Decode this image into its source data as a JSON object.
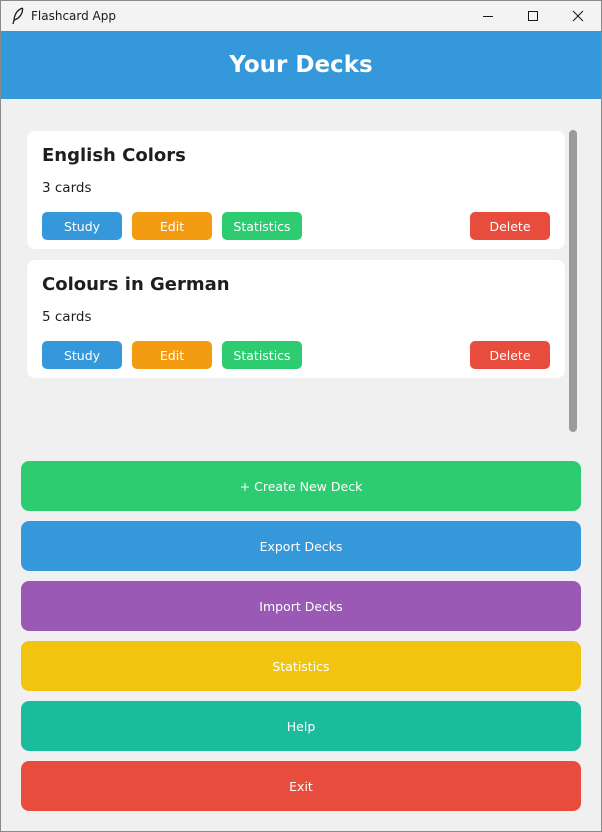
{
  "window": {
    "title": "Flashcard App",
    "icon": "feather-icon"
  },
  "header": {
    "title": "Your Decks"
  },
  "decks": [
    {
      "name": "English Colors",
      "count": "3 cards",
      "buttons": {
        "study": "Study",
        "edit": "Edit",
        "statistics": "Statistics",
        "delete": "Delete"
      }
    },
    {
      "name": "Colours in German",
      "count": "5 cards",
      "buttons": {
        "study": "Study",
        "edit": "Edit",
        "statistics": "Statistics",
        "delete": "Delete"
      }
    }
  ],
  "actions": {
    "create": "+ Create New Deck",
    "export": "Export Decks",
    "import": "Import Decks",
    "statistics": "Statistics",
    "help": "Help",
    "exit": "Exit"
  },
  "colors": {
    "header": "#3498db",
    "study": "#3498db",
    "edit": "#f39c12",
    "statistics": "#2ecc71",
    "delete": "#e74c3c",
    "create": "#2ecc71",
    "export": "#3498db",
    "import": "#9b59b6",
    "stats_action": "#f1c40f",
    "help": "#1abc9c",
    "exit": "#e74c3c"
  }
}
